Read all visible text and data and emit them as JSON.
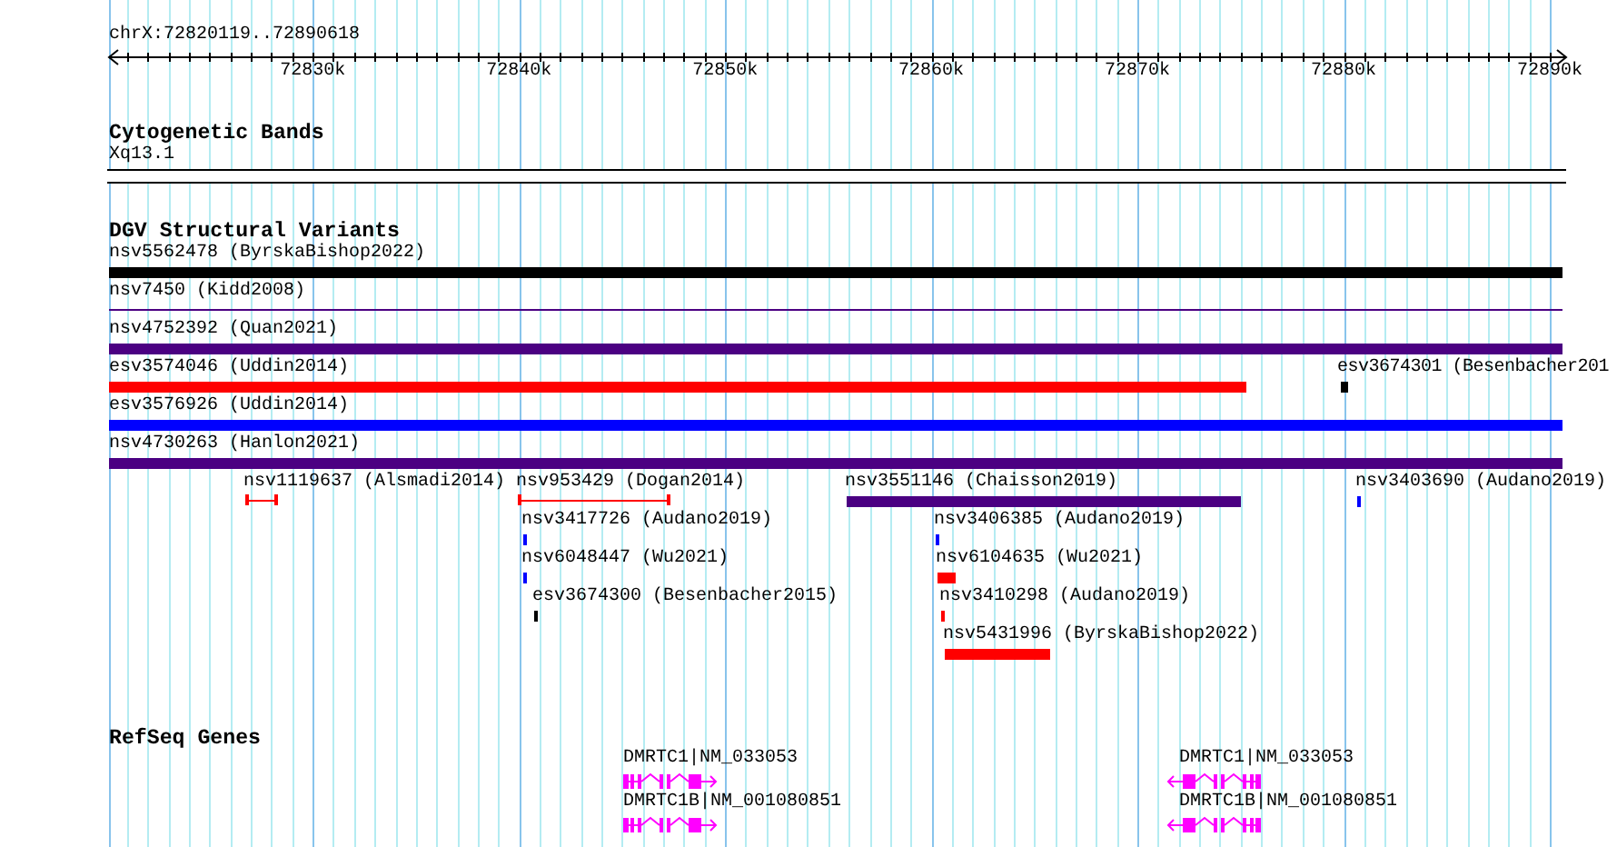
{
  "ruler": {
    "location": "chrX:72820119..72890618",
    "ticks": [
      "72830k",
      "72840k",
      "72850k",
      "72860k",
      "72870k",
      "72880k",
      "72890k"
    ]
  },
  "tracks": [
    {
      "title": "Cytogenetic Bands",
      "kind": "bands",
      "bands": [
        "Xq13.1"
      ]
    },
    {
      "title": "DGV Structural Variants",
      "kind": "variants",
      "features": [
        {
          "label": "nsv5562478 (ByrskaBishop2022)",
          "kind": "bar",
          "color": "#000000"
        },
        {
          "label": "nsv7450 (Kidd2008)",
          "kind": "line",
          "color": "#4b0082"
        },
        {
          "label": "nsv4752392 (Quan2021)",
          "kind": "bar",
          "color": "#4b0082"
        },
        {
          "label": "esv3574046 (Uddin2014)",
          "kind": "bar",
          "color": "#ff0000"
        },
        {
          "label": "esv3674301 (Besenbacher201",
          "kind": "bar",
          "color": "#000000"
        },
        {
          "label": "esv3576926 (Uddin2014)",
          "kind": "bar",
          "color": "#0000ff"
        },
        {
          "label": "nsv4730263 (Hanlon2021)",
          "kind": "bar",
          "color": "#4b0082"
        },
        {
          "label": "nsv1119637 (Alsmadi2014)",
          "kind": "span",
          "color": "#ff0000"
        },
        {
          "label": "nsv953429 (Dogan2014)",
          "kind": "span",
          "color": "#ff0000"
        },
        {
          "label": "nsv3551146 (Chaisson2019)",
          "kind": "bar",
          "color": "#4b0082"
        },
        {
          "label": "nsv3403690 (Audano2019)",
          "kind": "bar",
          "color": "#0000ff"
        },
        {
          "label": "nsv3417726 (Audano2019)",
          "kind": "bar",
          "color": "#0000ff"
        },
        {
          "label": "nsv3406385 (Audano2019)",
          "kind": "bar",
          "color": "#0000ff"
        },
        {
          "label": "nsv6048447 (Wu2021)",
          "kind": "bar",
          "color": "#0000ff"
        },
        {
          "label": "nsv6104635 (Wu2021)",
          "kind": "bar",
          "color": "#ff0000"
        },
        {
          "label": "esv3674300 (Besenbacher2015)",
          "kind": "bar",
          "color": "#000000"
        },
        {
          "label": "nsv3410298 (Audano2019)",
          "kind": "bar",
          "color": "#ff0000"
        },
        {
          "label": "nsv5431996 (ByrskaBishop2022)",
          "kind": "bar",
          "color": "#ff0000"
        }
      ]
    },
    {
      "title": "RefSeq Genes",
      "kind": "genes",
      "genes": [
        {
          "label": "DMRTC1|NM_033053",
          "reverse_strand": false
        },
        {
          "label": "DMRTC1|NM_033053",
          "reverse_strand": true
        },
        {
          "label": "DMRTC1B|NM_001080851",
          "reverse_strand": false
        },
        {
          "label": "DMRTC1B|NM_001080851",
          "reverse_strand": true
        }
      ]
    }
  ]
}
